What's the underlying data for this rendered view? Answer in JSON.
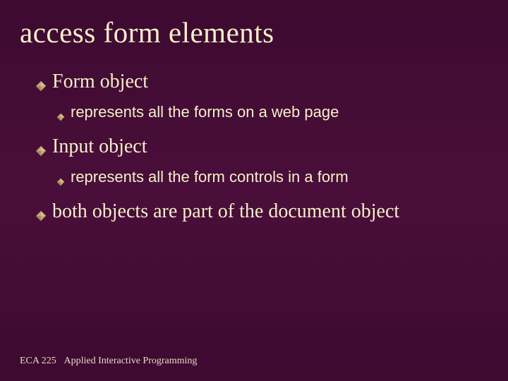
{
  "slide": {
    "title": "access form elements",
    "items": [
      {
        "level": 1,
        "text": "Form object"
      },
      {
        "level": 2,
        "text": "represents all the forms on a web page"
      },
      {
        "level": 1,
        "text": "Input object"
      },
      {
        "level": 2,
        "text": "represents all the form controls in a form"
      },
      {
        "level": 1,
        "text": "both objects are part of the document object"
      }
    ]
  },
  "footer": {
    "course": "ECA 225",
    "title": "Applied Interactive Programming"
  },
  "colors": {
    "background": "#4a0e3a",
    "text": "#f5f0c8",
    "bullet_fill": "#c9a876",
    "bullet_stroke": "#8a6d4a"
  }
}
